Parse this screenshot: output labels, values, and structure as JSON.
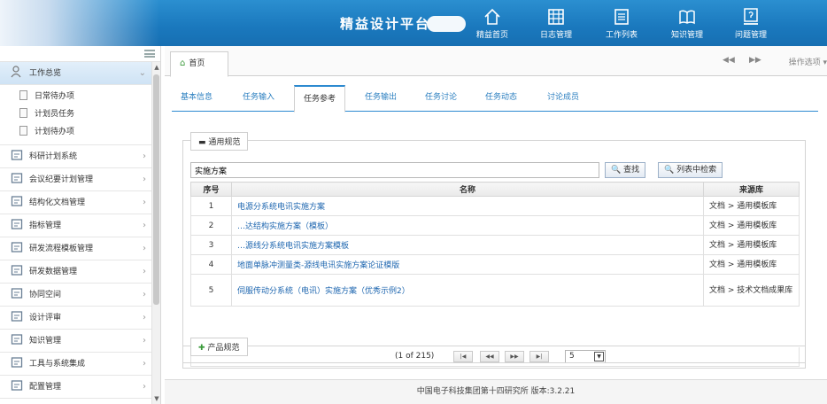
{
  "header": {
    "title": "精益设计平台",
    "nav": [
      {
        "label": "精益首页",
        "icon": "home-icon"
      },
      {
        "label": "日志管理",
        "icon": "grid-icon"
      },
      {
        "label": "工作列表",
        "icon": "list-icon"
      },
      {
        "label": "知识管理",
        "icon": "book-icon"
      },
      {
        "label": "问题管理",
        "icon": "question-icon"
      }
    ]
  },
  "sidebar": {
    "work_group": "工作总览",
    "work_items": [
      "日常待办项",
      "计划员任务",
      "计划待办项"
    ],
    "groups": [
      {
        "label": "科研计划系统",
        "icon": "calendar-icon"
      },
      {
        "label": "会议纪要计划管理",
        "icon": "meeting-icon"
      },
      {
        "label": "结构化文档管理",
        "icon": "document-icon"
      },
      {
        "label": "指标管理",
        "icon": "bar-chart-icon"
      },
      {
        "label": "研发流程模板管理",
        "icon": "flow-icon"
      },
      {
        "label": "研发数据管理",
        "icon": "data-icon"
      },
      {
        "label": "协同空间",
        "icon": "chat-icon"
      },
      {
        "label": "设计评审",
        "icon": "user-review-icon"
      },
      {
        "label": "知识管理",
        "icon": "book-icon"
      },
      {
        "label": "工具与系统集成",
        "icon": "tools-icon"
      },
      {
        "label": "配置管理",
        "icon": "config-icon"
      }
    ]
  },
  "tabs": {
    "home": "首页",
    "operations": "操作选项",
    "sub": [
      "基本信息",
      "任务输入",
      "任务参考",
      "任务输出",
      "任务讨论",
      "任务动态",
      "讨论成员"
    ],
    "active_sub": "任务参考"
  },
  "general": {
    "legend": "通用规范",
    "search_value": "实施方案",
    "search_button": "查找",
    "list_search_button": "列表中检索",
    "columns": {
      "index": "序号",
      "name": "名称",
      "source": "来源库"
    },
    "rows": [
      {
        "index": "1",
        "name": "电源分系统电讯实施方案",
        "source": "文档 > 通用模板库"
      },
      {
        "index": "2",
        "name": "…达结构实施方案（模板）",
        "source": "文档 > 通用模板库"
      },
      {
        "index": "3",
        "name": "…源线分系统电讯实施方案模板",
        "source": "文档 > 通用模板库"
      },
      {
        "index": "4",
        "name": "地面单脉冲测量类-源线电讯实施方案论证模版",
        "source": "文档 > 通用模板库"
      },
      {
        "index": "5",
        "name": "伺服传动分系统（电讯）实施方案（优秀示例2）",
        "source": "文档 > 技术文档成果库"
      }
    ],
    "pager_info": "(1 of 215)",
    "page_size": "5",
    "pager_buttons": [
      "|◀",
      "◀◀",
      "▶▶",
      "▶|"
    ]
  },
  "product": {
    "legend": "产品规范"
  },
  "footer": {
    "text": "中国电子科技集团第十四研究所   版本:3.2.21"
  },
  "colors": {
    "header": "#1a78bd",
    "link": "#1f67b0",
    "accent": "#2d8ad0"
  }
}
